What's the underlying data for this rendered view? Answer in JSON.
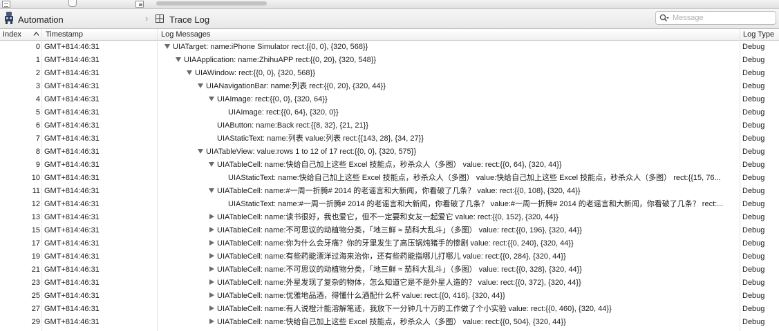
{
  "header": {
    "left_title": "Automation",
    "right_title": "Trace Log",
    "search_placeholder": "Message"
  },
  "columns": [
    "Index",
    "Timestamp",
    "Log Messages",
    "Log Type"
  ],
  "rows": [
    {
      "index": "0",
      "timestamp": "GMT+814:46:31",
      "depth": 0,
      "toggle": "open",
      "message": "UIATarget: name:iPhone Simulator rect:{{0, 0}, {320, 568}}",
      "type": "Debug"
    },
    {
      "index": "1",
      "timestamp": "GMT+814:46:31",
      "depth": 1,
      "toggle": "open",
      "message": "UIAApplication: name:ZhihuAPP rect:{{0, 20}, {320, 548}}",
      "type": "Debug"
    },
    {
      "index": "2",
      "timestamp": "GMT+814:46:31",
      "depth": 2,
      "toggle": "open",
      "message": "UIAWindow: rect:{{0, 0}, {320, 568}}",
      "type": "Debug"
    },
    {
      "index": "3",
      "timestamp": "GMT+814:46:31",
      "depth": 3,
      "toggle": "open",
      "message": "UIANavigationBar: name:列表 rect:{{0, 20}, {320, 44}}",
      "type": "Debug"
    },
    {
      "index": "4",
      "timestamp": "GMT+814:46:31",
      "depth": 4,
      "toggle": "open",
      "message": "UIAImage: rect:{{0, 0}, {320, 64}}",
      "type": "Debug"
    },
    {
      "index": "5",
      "timestamp": "GMT+814:46:31",
      "depth": 5,
      "toggle": "none",
      "message": "UIAImage: rect:{{0, 64}, {320, 0}}",
      "type": "Debug"
    },
    {
      "index": "6",
      "timestamp": "GMT+814:46:31",
      "depth": 4,
      "toggle": "none",
      "message": "UIAButton: name:Back rect:{{8, 32}, {21, 21}}",
      "type": "Debug"
    },
    {
      "index": "7",
      "timestamp": "GMT+814:46:31",
      "depth": 4,
      "toggle": "none",
      "message": "UIAStaticText: name:列表 value:列表 rect:{{143, 28}, {34, 27}}",
      "type": "Debug"
    },
    {
      "index": "8",
      "timestamp": "GMT+814:46:31",
      "depth": 3,
      "toggle": "open",
      "message": "UIATableView: value:rows 1 to 12 of 17 rect:{{0, 0}, {320, 575}}",
      "type": "Debug"
    },
    {
      "index": "9",
      "timestamp": "GMT+814:46:31",
      "depth": 4,
      "toggle": "open",
      "message": "UIATableCell: name:快给自己加上这些 Excel 技能点，秒杀众人（多图） value: rect:{{0, 64}, {320, 44}}",
      "type": "Debug"
    },
    {
      "index": "10",
      "timestamp": "GMT+814:46:31",
      "depth": 5,
      "toggle": "none",
      "message": "UIAStaticText: name:快给自己加上这些 Excel 技能点，秒杀众人（多图） value:快给自己加上这些 Excel 技能点，秒杀众人（多图） rect:{{15, 76...",
      "type": "Debug"
    },
    {
      "index": "11",
      "timestamp": "GMT+814:46:31",
      "depth": 4,
      "toggle": "open",
      "message": "UIATableCell: name:#一周一折腾# 2014 的老谣言和大新闻，你看破了几条？ value: rect:{{0, 108}, {320, 44}}",
      "type": "Debug"
    },
    {
      "index": "12",
      "timestamp": "GMT+814:46:31",
      "depth": 5,
      "toggle": "none",
      "message": "UIAStaticText: name:#一周一折腾# 2014 的老谣言和大新闻，你看破了几条？ value:#一周一折腾# 2014 的老谣言和大新闻，你看破了几条？ rect:...",
      "type": "Debug"
    },
    {
      "index": "13",
      "timestamp": "GMT+814:46:31",
      "depth": 4,
      "toggle": "closed",
      "message": "UIATableCell: name:读书很好，我也爱它，但不一定要和女友一起爱它 value: rect:{{0, 152}, {320, 44}}",
      "type": "Debug"
    },
    {
      "index": "15",
      "timestamp": "GMT+814:46:31",
      "depth": 4,
      "toggle": "closed",
      "message": "UIATableCell: name:不可思议的动植物分类，「地三鲜 ≈ 茄科大乱斗」（多图） value: rect:{{0, 196}, {320, 44}}",
      "type": "Debug"
    },
    {
      "index": "17",
      "timestamp": "GMT+814:46:31",
      "depth": 4,
      "toggle": "closed",
      "message": "UIATableCell: name:你为什么会牙痛？你的牙里发生了高压锅炖猪手的惨剧 value: rect:{{0, 240}, {320, 44}}",
      "type": "Debug"
    },
    {
      "index": "19",
      "timestamp": "GMT+814:46:31",
      "depth": 4,
      "toggle": "closed",
      "message": "UIATableCell: name:有些药能漂洋过海来治你，还有些药能指哪儿打哪儿 value: rect:{{0, 284}, {320, 44}}",
      "type": "Debug"
    },
    {
      "index": "21",
      "timestamp": "GMT+814:46:31",
      "depth": 4,
      "toggle": "closed",
      "message": "UIATableCell: name:不可思议的动植物分类，「地三鲜 ≈ 茄科大乱斗」（多图） value: rect:{{0, 328}, {320, 44}}",
      "type": "Debug"
    },
    {
      "index": "23",
      "timestamp": "GMT+814:46:31",
      "depth": 4,
      "toggle": "closed",
      "message": "UIATableCell: name:外星发现了复杂的物体，怎么知道它是不是外星人造的？ value: rect:{{0, 372}, {320, 44}}",
      "type": "Debug"
    },
    {
      "index": "25",
      "timestamp": "GMT+814:46:31",
      "depth": 4,
      "toggle": "closed",
      "message": "UIATableCell: name:优雅地品酒，得懂什么酒配什么杯 value: rect:{{0, 416}, {320, 44}}",
      "type": "Debug"
    },
    {
      "index": "27",
      "timestamp": "GMT+814:46:31",
      "depth": 4,
      "toggle": "closed",
      "message": "UIATableCell: name:有人说橙汁能溶解笔迹，我放下一分钟几十万的工作做了个小实验 value: rect:{{0, 460}, {320, 44}}",
      "type": "Debug"
    },
    {
      "index": "29",
      "timestamp": "GMT+814:46:31",
      "depth": 4,
      "toggle": "closed",
      "message": "UIATableCell: name:快给自己加上这些 Excel 技能点，秒杀众人（多图） value: rect:{{0, 504}, {320, 44}}",
      "type": "Debug"
    }
  ]
}
